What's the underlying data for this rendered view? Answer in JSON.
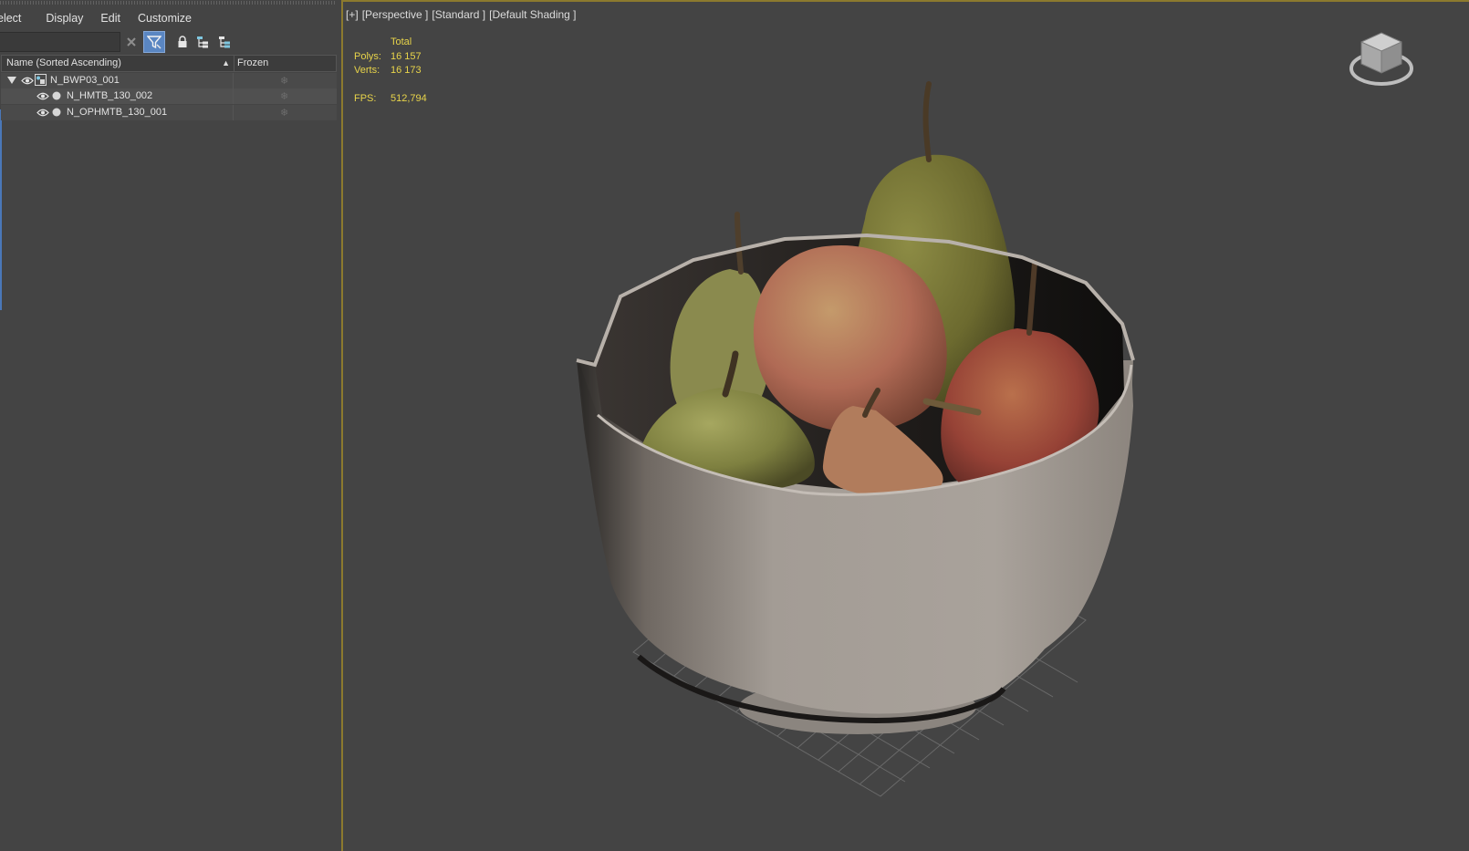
{
  "menu": {
    "items": [
      "elect",
      "Display",
      "Edit",
      "Customize"
    ]
  },
  "toolbar": {
    "search_value": "",
    "icons": [
      "close-icon",
      "filter-icon",
      "lock-icon",
      "hierarchy-icon",
      "hierarchy-alt-icon"
    ]
  },
  "explorer": {
    "columns": {
      "name": "Name (Sorted Ascending)",
      "frozen": "Frozen"
    },
    "rows": [
      {
        "name": "N_BWP03_001",
        "expanded": true,
        "level": 0
      },
      {
        "name": "N_HMTB_130_002",
        "level": 1
      },
      {
        "name": "N_OPHMTB_130_001",
        "level": 1
      }
    ]
  },
  "viewport": {
    "labels": [
      "[+]",
      "[Perspective ]",
      "[Standard ]",
      "[Default Shading ]"
    ],
    "stats": {
      "header": "Total",
      "polys_label": "Polys:",
      "polys": "16 157",
      "verts_label": "Verts:",
      "verts": "16 173",
      "fps_label": "FPS:",
      "fps": "512,794"
    },
    "stat_color": "#e8d44a",
    "accent_border": "#8c7a2e"
  },
  "colors": {
    "selected_button": "#5a86c2",
    "panel_bg": "#444444"
  }
}
